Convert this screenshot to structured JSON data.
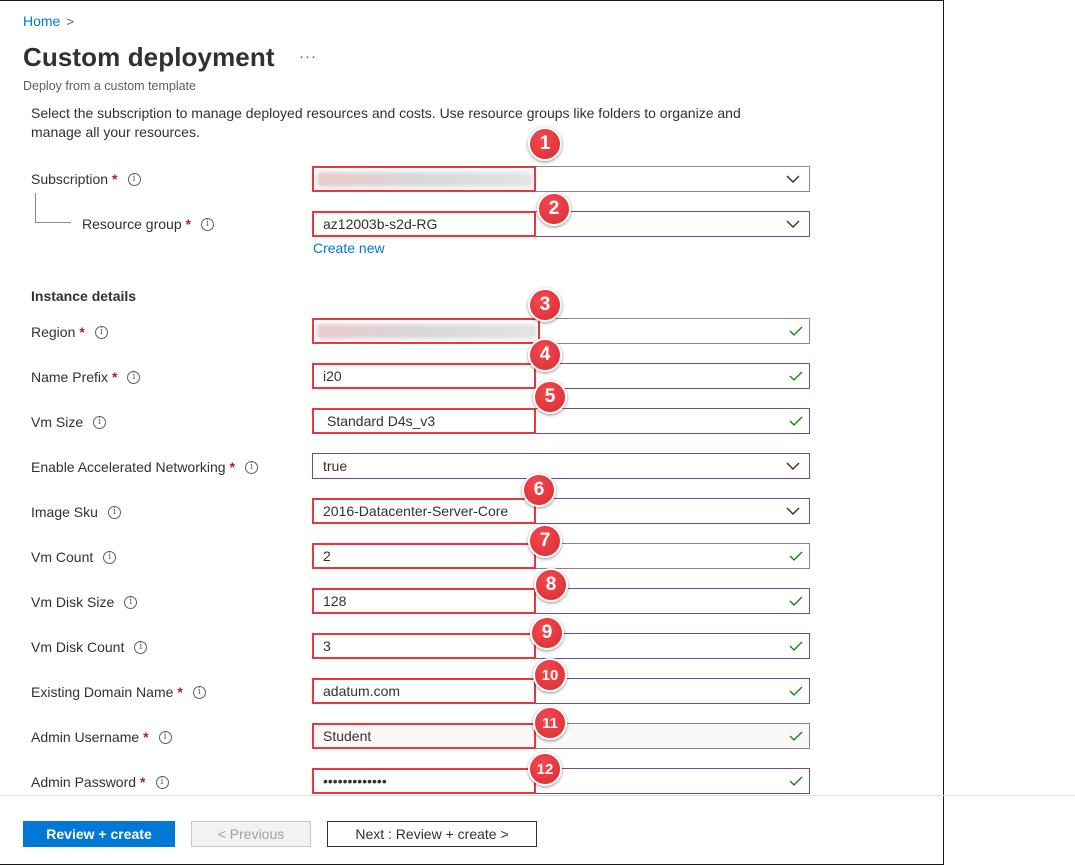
{
  "breadcrumb": {
    "home": "Home",
    "separator": ">"
  },
  "header": {
    "title": "Custom deployment",
    "more": "···",
    "subtitle": "Deploy from a custom template"
  },
  "intro": "Select the subscription to manage deployed resources and costs. Use resource groups like folders to organize and manage all your resources.",
  "section_instance": "Instance details",
  "info_glyph": "i",
  "required_mark": "*",
  "fields": {
    "subscription": {
      "label": "Subscription",
      "value": "",
      "callout": "1"
    },
    "resource_group": {
      "label": "Resource group",
      "value": "az12003b-s2d-RG",
      "callout": "2",
      "create_new": "Create new"
    },
    "region": {
      "label": "Region",
      "value": "",
      "callout": "3"
    },
    "name_prefix": {
      "label": "Name Prefix",
      "value": "i20",
      "callout": "4"
    },
    "vm_size": {
      "label": "Vm Size",
      "value": "Standard D4s_v3",
      "callout": "5"
    },
    "accel_net": {
      "label": "Enable Accelerated Networking",
      "value": "true"
    },
    "image_sku": {
      "label": "Image Sku",
      "value": "2016-Datacenter-Server-Core",
      "callout": "6"
    },
    "vm_count": {
      "label": "Vm Count",
      "value": "2",
      "callout": "7"
    },
    "vm_disk_size": {
      "label": "Vm Disk Size",
      "value": "128",
      "callout": "8"
    },
    "vm_disk_count": {
      "label": "Vm Disk Count",
      "value": "3",
      "callout": "9"
    },
    "domain_name": {
      "label": "Existing Domain Name",
      "value": "adatum.com",
      "callout": "10"
    },
    "admin_username": {
      "label": "Admin Username",
      "value": "Student",
      "callout": "11"
    },
    "admin_password": {
      "label": "Admin Password",
      "value": "•••••••••••••",
      "callout": "12"
    }
  },
  "footer": {
    "review_create": "Review + create",
    "previous": "< Previous",
    "next": "Next : Review + create >"
  },
  "colors": {
    "accent": "#0078d4",
    "highlight": "#e8373f",
    "valid": "#107c10",
    "required": "#a4262c"
  },
  "icons": {
    "dropdown": "chevron-down-icon",
    "valid": "checkmark-icon",
    "info": "info-icon"
  }
}
